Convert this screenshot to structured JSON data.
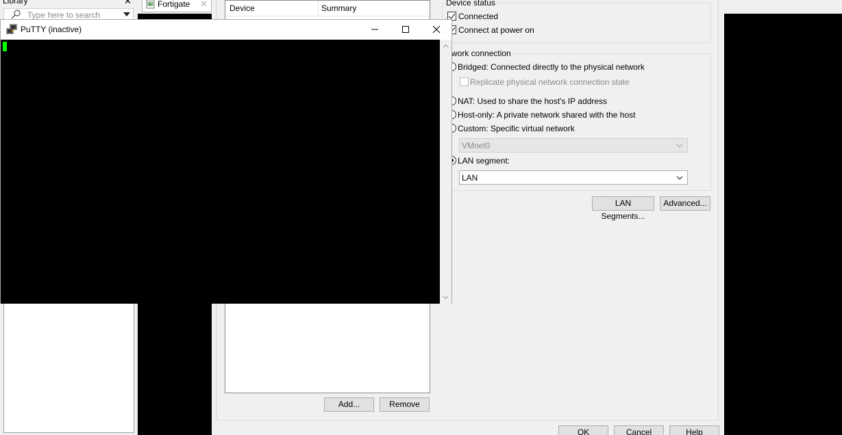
{
  "library": {
    "title": "Library",
    "search_placeholder": "Type here to search"
  },
  "vm_tab": {
    "label": "Fortigate"
  },
  "settings": {
    "device_list": {
      "columns": [
        "Device",
        "Summary"
      ]
    },
    "buttons": {
      "add": "Add...",
      "remove": "Remove",
      "ok": "OK",
      "cancel": "Cancel",
      "help": "Help"
    },
    "device_status": {
      "legend": "Device status",
      "connected": {
        "label": "Connected",
        "checked": true
      },
      "connect_at_power_on": {
        "label": "Connect at power on",
        "checked": true
      }
    },
    "network_connection": {
      "legend": "etwork connection",
      "bridged": "Bridged: Connected directly to the physical network",
      "replicate": "Replicate physical network connection state",
      "nat": "NAT: Used to share the host's IP address",
      "host_only": "Host-only: A private network shared with the host",
      "custom": "Custom: Specific virtual network",
      "custom_value": "VMnet0",
      "lan_segment": "LAN segment:",
      "lan_segment_value": "LAN",
      "selected": "lan_segment"
    },
    "lan_segments_button": "LAN Segments...",
    "advanced_button": "Advanced..."
  },
  "putty": {
    "title": "PuTTY (inactive)",
    "cursor_color": "#00ff00"
  }
}
